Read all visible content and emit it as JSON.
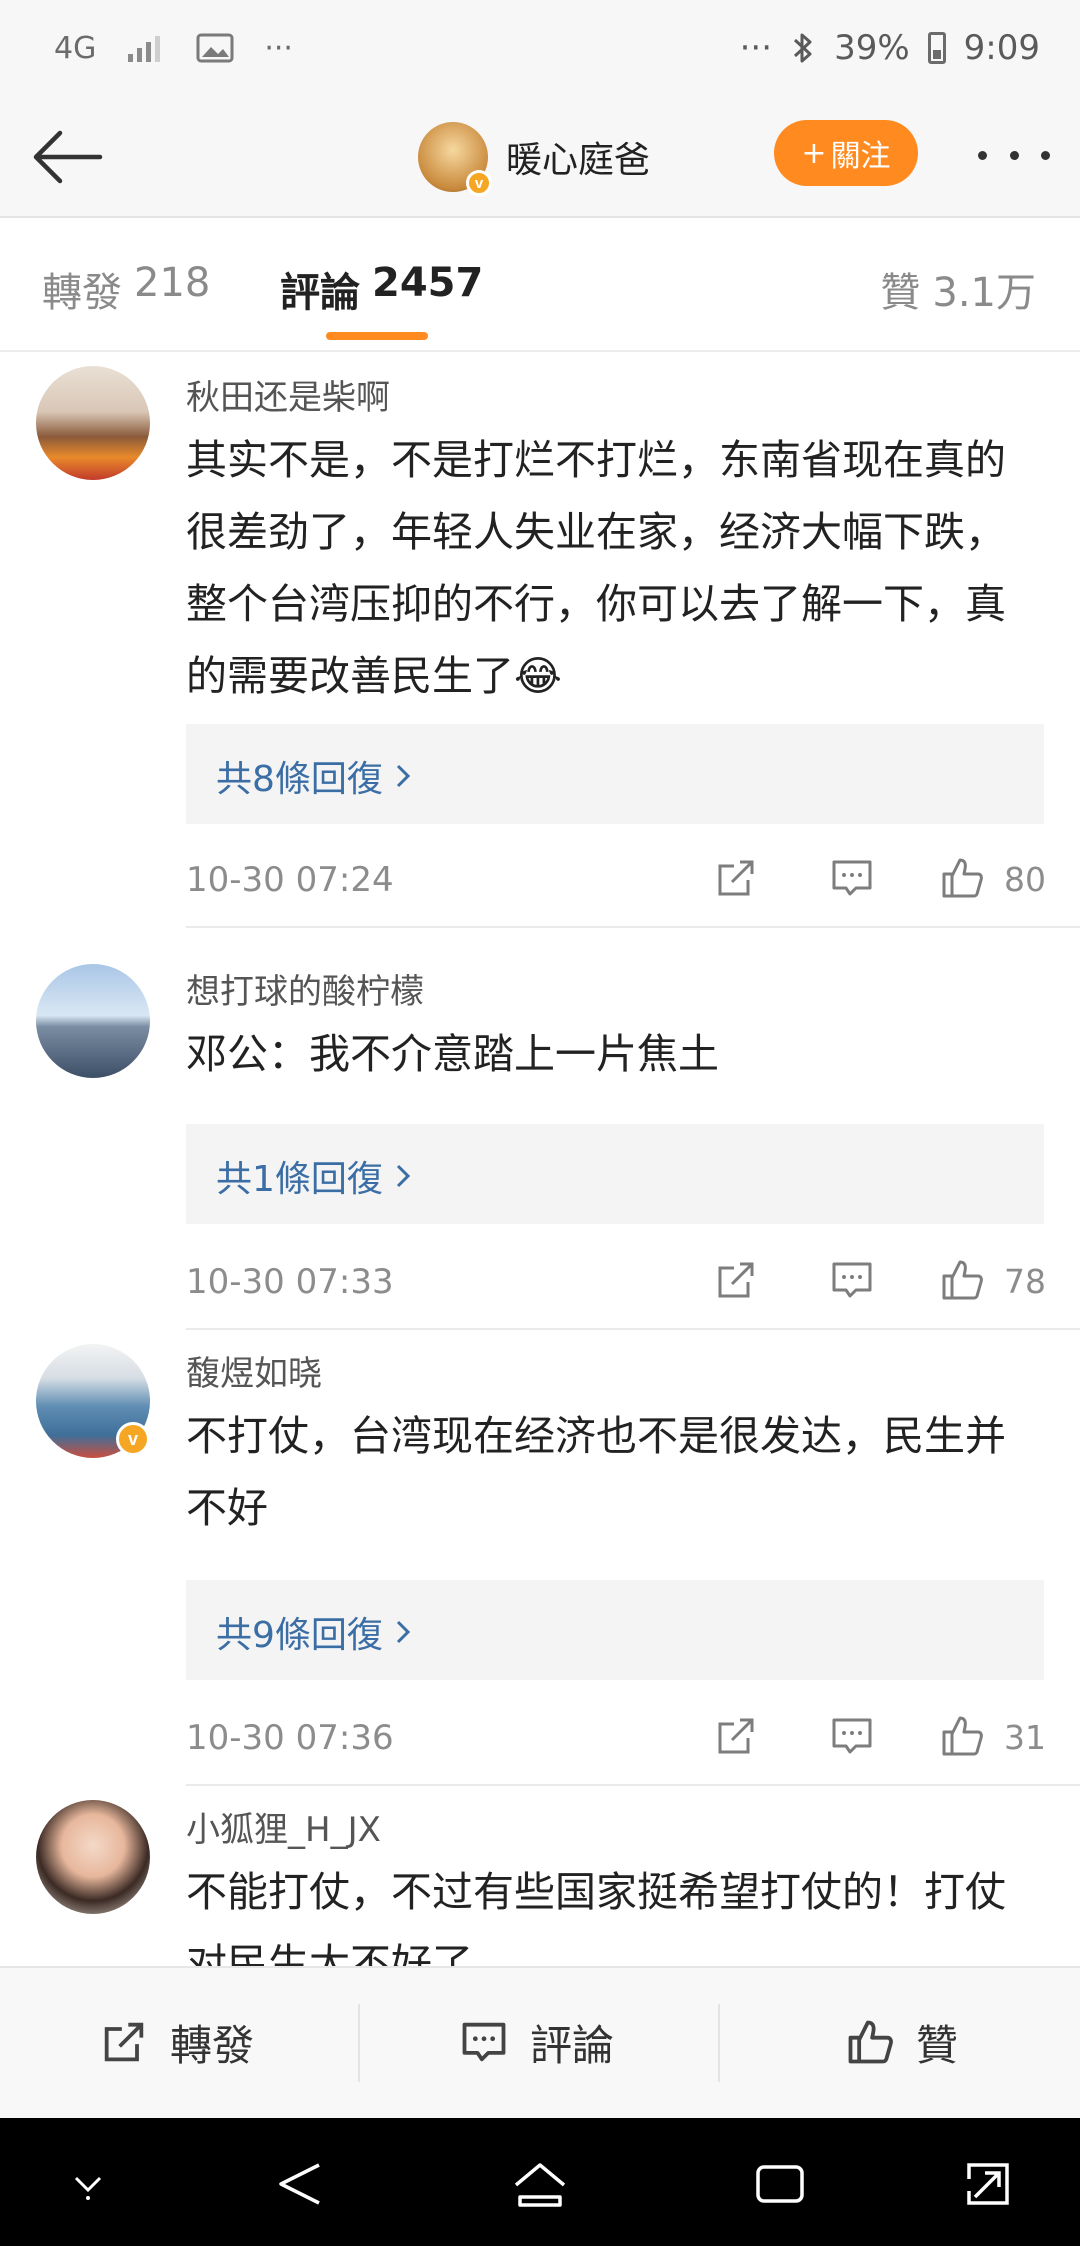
{
  "status_bar": {
    "network": "4G",
    "more": "···",
    "right_more": "···",
    "battery": "39%",
    "time": "9:09"
  },
  "header": {
    "user_name": "暖心庭爸",
    "follow_label": "關注",
    "follow_plus": "+"
  },
  "tabs": {
    "repost_label": "轉發",
    "repost_count": "218",
    "comment_label": "評論",
    "comment_count": "2457",
    "like_label": "贊",
    "like_count": "3.1万"
  },
  "comments": [
    {
      "user": "秋田还是柴啊",
      "text": "其实不是，不是打烂不打烂，东南省现在真的很差劲了，年轻人失业在家，经济大幅下跌，整个台湾压抑的不行，你可以去了解一下，真的需要改善民生了😂",
      "replies": "共8條回復",
      "time": "10-30 07:24",
      "likes": "80"
    },
    {
      "user": "想打球的酸柠檬",
      "text": "邓公：我不介意踏上一片焦土",
      "replies": "共1條回復",
      "time": "10-30 07:33",
      "likes": "78"
    },
    {
      "user": "馥煜如晓",
      "text": "不打仗，台湾现在经济也不是很发达，民生并不好",
      "replies": "共9條回復",
      "time": "10-30 07:36",
      "likes": "31"
    },
    {
      "user": "小狐狸_H_JX",
      "text": "不能打仗，不过有些国家挺希望打仗的！打仗对民生太不好了"
    }
  ],
  "bottom_bar": {
    "repost": "轉發",
    "comment": "評論",
    "like": "贊"
  },
  "icons": {
    "accent": "#ff8a1f",
    "link": "#3b6ea5"
  }
}
